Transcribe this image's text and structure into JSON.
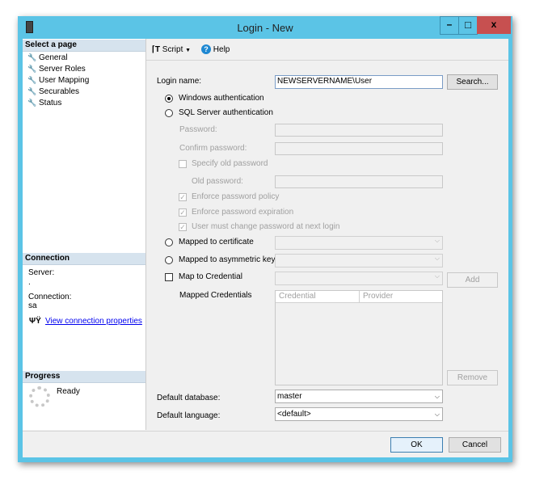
{
  "window": {
    "title": "Login - New",
    "controls": {
      "minimize": "–",
      "maximize": "□",
      "close": "x"
    },
    "accent": "#5bc4e6",
    "close_color": "#c75050"
  },
  "sidebar": {
    "header": "Select a page",
    "items": [
      {
        "label": "General"
      },
      {
        "label": "Server Roles"
      },
      {
        "label": "User Mapping"
      },
      {
        "label": "Securables"
      },
      {
        "label": "Status"
      }
    ]
  },
  "connection": {
    "header": "Connection",
    "server_label": "Server:",
    "server_value": ".",
    "connection_label": "Connection:",
    "connection_value": "sa",
    "link": "View connection properties"
  },
  "progress": {
    "header": "Progress",
    "status": "Ready"
  },
  "toolbar": {
    "script": "Script",
    "help": "Help"
  },
  "form": {
    "login_name_label": "Login name:",
    "login_name_value": "NEWSERVERNAME\\User",
    "search": "Search...",
    "windows_auth": "Windows authentication",
    "sql_auth": "SQL Server authentication",
    "password": "Password:",
    "confirm_password": "Confirm password:",
    "specify_old": "Specify old password",
    "old_password": "Old password:",
    "enforce_policy": "Enforce password policy",
    "enforce_expiration": "Enforce password expiration",
    "must_change": "User must change password at next login",
    "mapped_cert": "Mapped to certificate",
    "mapped_key": "Mapped to asymmetric key",
    "map_credential": "Map to Credential",
    "add": "Add",
    "mapped_credentials": "Mapped Credentials",
    "columns": [
      "Credential",
      "Provider"
    ],
    "remove": "Remove",
    "default_db_label": "Default database:",
    "default_db_value": "master",
    "default_lang_label": "Default language:",
    "default_lang_value": "<default>"
  },
  "buttons": {
    "ok": "OK",
    "cancel": "Cancel"
  }
}
